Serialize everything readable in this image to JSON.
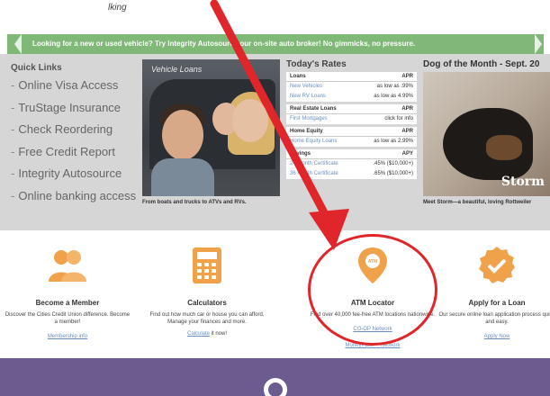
{
  "annotation": {
    "top_text": "lking"
  },
  "banner": {
    "text": "Looking for a new or used vehicle? Try Integrity Autosource our on-site auto broker! No gimmicks, no pressure."
  },
  "quick_links": {
    "title": "Quick Links",
    "items": [
      {
        "label": "Online Visa Access"
      },
      {
        "label": "TruStage Insurance"
      },
      {
        "label": "Check Reordering"
      },
      {
        "label": "Free Credit Report"
      },
      {
        "label": "Integrity Autosource"
      },
      {
        "label": "Online banking access"
      }
    ]
  },
  "vehicle_photo": {
    "label": "Vehicle Loans",
    "caption": "From boats and trucks to ATVs and RVs."
  },
  "rates": {
    "title": "Today's Rates",
    "groups": [
      {
        "header": "Loans",
        "unit": "APR",
        "rows": [
          {
            "name": "New Vehicles",
            "value": "as low as .99%"
          },
          {
            "name": "New RV Loans",
            "value": "as low as 4.99%"
          }
        ]
      },
      {
        "header": "Real Estate Loans",
        "unit": "APR",
        "rows": [
          {
            "name": "First Mortgages",
            "value": "click for info"
          }
        ]
      },
      {
        "header": "Home Equity",
        "unit": "APR",
        "rows": [
          {
            "name": "Home Equity Loans",
            "value": "as low as 2.99%"
          }
        ]
      },
      {
        "header": "Savings",
        "unit": "APY",
        "rows": [
          {
            "name": "24 Month Certificate",
            "value": ".45% ($10,000+)"
          },
          {
            "name": "36 Month Certificate",
            "value": ".65% ($10,000+)"
          }
        ]
      }
    ]
  },
  "dog": {
    "title": "Dog of the Month - Sept. 20",
    "name": "Storm",
    "caption": "Meet Storm—a beautiful, loving Rottweiler"
  },
  "features": [
    {
      "title": "Become a Member",
      "desc": "Discover the Cities Credit Union difference. Become a member!",
      "link": "Membership info",
      "icon": "members-icon",
      "color": "#f0a24a"
    },
    {
      "title": "Calculators",
      "desc": "Find out how much car or house you can afford. Manage your finances and more.",
      "link": "Calculate",
      "link_suffix": " it now!",
      "icon": "calculator-icon",
      "color": "#f0a24a"
    },
    {
      "title": "ATM Locator",
      "desc": "Find over 40,000 fee-free ATM locations nationwide.",
      "link": "CO-OP Network",
      "link2": "MoneyPass™ Network",
      "icon": "atm-pin-icon",
      "color": "#f0a24a"
    },
    {
      "title": "Apply for a Loan",
      "desc": "Our secure online loan application process quick and easy.",
      "link": "Apply Now",
      "icon": "checkmark-icon",
      "color": "#f0a24a"
    }
  ],
  "colors": {
    "banner": "#7fb877",
    "accent": "#f0a24a",
    "highlight": "#e0262b",
    "footer": "#6b5b8e"
  }
}
